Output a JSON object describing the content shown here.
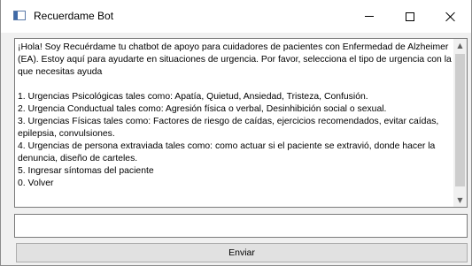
{
  "window": {
    "title": "Recuerdame Bot",
    "minimize_glyph": "minimize-icon",
    "maximize_glyph": "maximize-icon",
    "close_glyph": "close-icon"
  },
  "chat": {
    "intro": "¡Hola! Soy Recuérdame tu chatbot de apoyo para cuidadores de pacientes con Enfermedad de Alzheimer (EA). Estoy aquí para ayudarte en situaciones de urgencia. Por favor, selecciona el tipo de urgencia con la que necesitas ayuda",
    "options": [
      "1. Urgencias Psicológicas tales como: Apatía, Quietud, Ansiedad, Tristeza, Confusión.",
      "2. Urgencia Conductual tales como: Agresión física o verbal, Desinhibición social o sexual.",
      "3. Urgencias Físicas tales como: Factores de riesgo de caídas, ejercicios recomendados, evitar caídas, epilepsia, convulsiones.",
      "4. Urgencias de persona extraviada tales como: como actuar si el paciente se extravió, donde hacer la denuncia, diseño de carteles.",
      "5. Ingresar síntomas del paciente",
      "0. Volver"
    ]
  },
  "input": {
    "value": "",
    "placeholder": ""
  },
  "send_button": {
    "label": "Enviar"
  },
  "colors": {
    "window_bg": "#f0f0f0",
    "button_bg": "#e1e1e1",
    "scroll_thumb": "#cdcdcd"
  }
}
